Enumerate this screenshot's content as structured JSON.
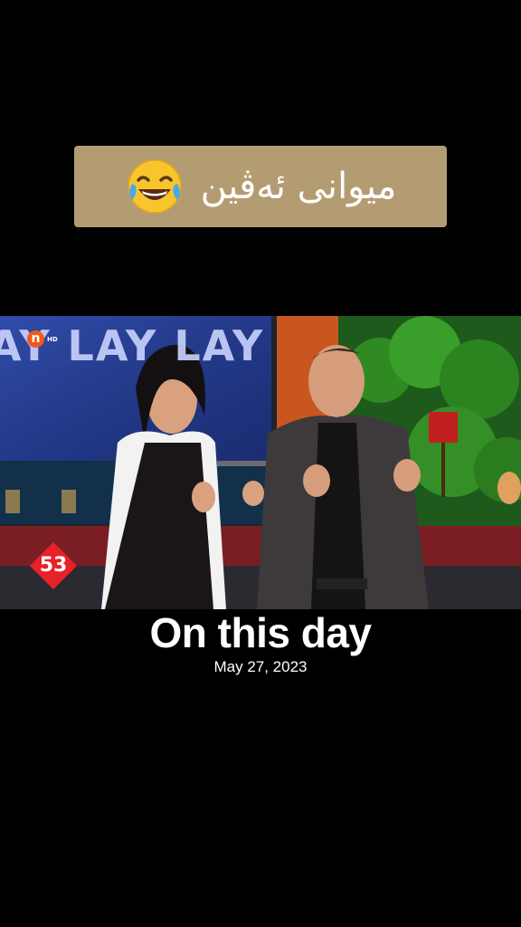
{
  "caption": {
    "text": "میوانی ئەڤین",
    "emoji_icon": "face-with-tears-of-joy-icon"
  },
  "video": {
    "channel_logo_letter": "n",
    "channel_logo_suffix": "HD",
    "show_title": "AY LAY LAY",
    "episode_number": "53"
  },
  "memory": {
    "title": "On this day",
    "date": "May 27, 2023"
  },
  "colors": {
    "background": "#000000",
    "caption_box": "#b49c72",
    "channel_logo": "#f05a1a",
    "episode_badge": "#e8202a"
  }
}
